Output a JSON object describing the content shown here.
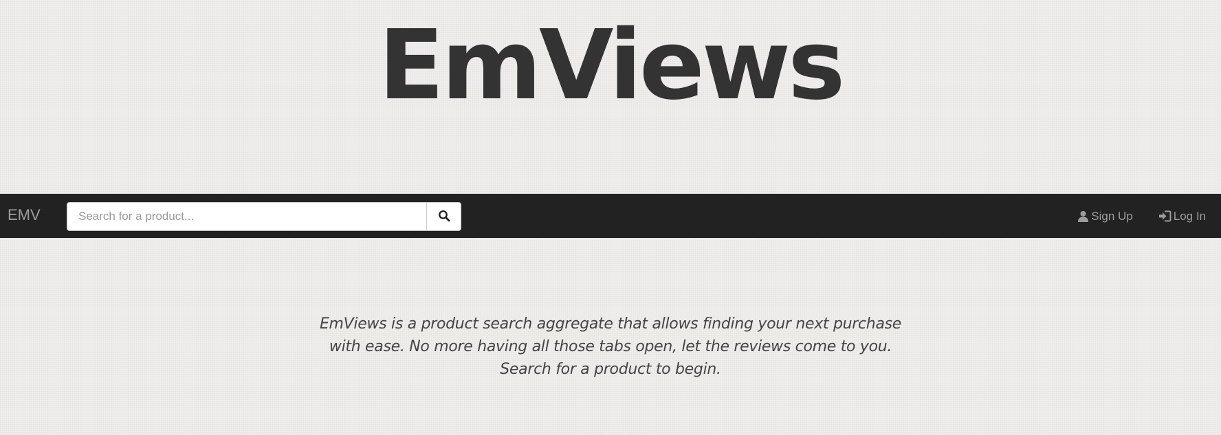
{
  "hero": {
    "logo_text": "EmViews"
  },
  "navbar": {
    "brand": "EMV",
    "search": {
      "placeholder": "Search for a product...",
      "value": "",
      "button_icon": "search-icon"
    },
    "links": {
      "signup_label": "Sign Up",
      "signup_icon": "user-icon",
      "login_label": "Log In",
      "login_icon": "log-in-icon"
    },
    "colors": {
      "background": "#222222",
      "link": "#9d9d9d"
    }
  },
  "main": {
    "description": "EmViews is a product search aggregate that allows finding your next purchase with ease. No more having all those tabs open, let the reviews come to you. Search for a product to begin."
  }
}
